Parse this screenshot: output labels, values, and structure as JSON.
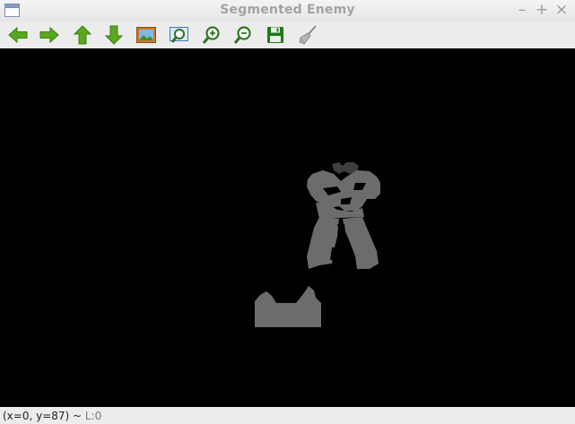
{
  "window": {
    "title": "Segmented Enemy",
    "controls": [
      "–",
      "+",
      "×"
    ]
  },
  "toolbar": {
    "buttons": [
      {
        "name": "back-arrow-icon",
        "label": "Previous",
        "color": "#4f9e1c"
      },
      {
        "name": "forward-arrow-icon",
        "label": "Next",
        "color": "#4f9e1c"
      },
      {
        "name": "up-arrow-icon",
        "label": "Up",
        "color": "#4f9e1c"
      },
      {
        "name": "down-arrow-icon",
        "label": "Down",
        "color": "#4f9e1c"
      },
      {
        "name": "picture-icon",
        "label": "Image"
      },
      {
        "name": "zoom-fit-icon",
        "label": "Zoom to fit"
      },
      {
        "name": "zoom-in-icon",
        "label": "Zoom in"
      },
      {
        "name": "zoom-out-icon",
        "label": "Zoom out"
      },
      {
        "name": "save-icon",
        "label": "Save"
      },
      {
        "name": "broom-icon",
        "label": "Clear"
      }
    ]
  },
  "status": {
    "coords": "(x=0, y=87) ~ ",
    "level": "L:0"
  },
  "colors": {
    "canvas_background": "#000000",
    "segment_gray": "#6c6c6c",
    "segment_dark": "#3e3e3e",
    "icon_green": "#4f9e1c",
    "save_green": "#1f7a1a"
  }
}
